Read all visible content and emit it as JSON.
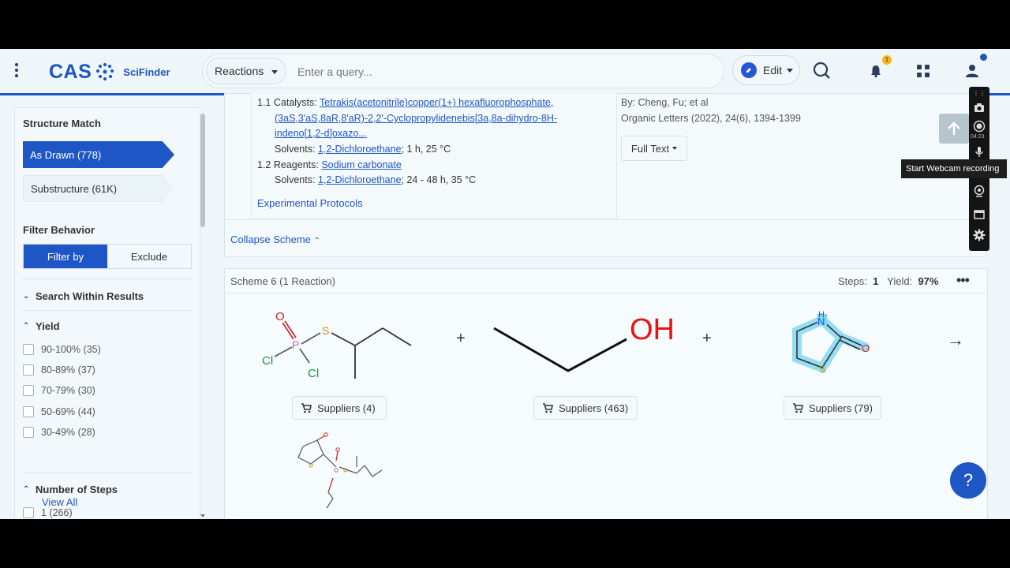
{
  "header": {
    "logo_text": "CAS",
    "product": "SciFinder",
    "search_type": "Reactions",
    "search_placeholder": "Enter a query...",
    "edit_label": "Edit",
    "notification_count": "1",
    "colors": {
      "brand": "#1f56c6",
      "accent_badge": "#f3b81c"
    }
  },
  "sidebar": {
    "structure_match_title": "Structure Match",
    "as_drawn": "As Drawn (778)",
    "substructure": "Substructure (61K)",
    "filter_behavior_title": "Filter Behavior",
    "filter_by": "Filter by",
    "exclude": "Exclude",
    "search_within": "Search Within Results",
    "yield_title": "Yield",
    "yield_options": [
      {
        "label": "90-100%",
        "count": "(35)"
      },
      {
        "label": "80-89%",
        "count": "(37)"
      },
      {
        "label": "70-79%",
        "count": "(30)"
      },
      {
        "label": "50-69%",
        "count": "(44)"
      },
      {
        "label": "30-49%",
        "count": "(28)"
      }
    ],
    "view_all": "View All",
    "steps_title": "Number of Steps",
    "steps_option": {
      "label": "1",
      "count": "(266)"
    }
  },
  "conditions": {
    "step1_prefix": "1.1",
    "catalysts_label": "Catalysts:",
    "catalyst1": "Tetrakis(acetonitrile)copper(1+) hexafluorophosphate,",
    "catalyst2": "(3aS,3'aS,8aR,8'aR)-2,2'-Cyclopropylidenebis[3a,8a-dihydro-8H-",
    "catalyst3": "indeno[1,2-d]oxazo...",
    "solvents_label": "Solvents:",
    "solvent1": "1,2-Dichloroethane",
    "solvent1_cond": "; 1 h, 25 °C",
    "step2_prefix": "1.2",
    "reagents_label": "Reagents:",
    "reagent": "Sodium carbonate",
    "solvent2": "1,2-Dichloroethane",
    "solvent2_cond": "; 24 - 48 h, 35 °C",
    "experimental_protocols": "Experimental Protocols"
  },
  "reference": {
    "byline": "By: Cheng, Fu; et al",
    "journal": "Organic Letters (2022), 24(6), 1394-1399",
    "full_text": "Full Text"
  },
  "collapse_scheme": "Collapse Scheme",
  "scheme": {
    "title": "Scheme 6",
    "reactions": "(1 Reaction)",
    "steps_label": "Steps:",
    "steps_value": "1",
    "yield_label": "Yield:",
    "yield_value": "97%",
    "suppliers": [
      "Suppliers (4)",
      "Suppliers (463)",
      "Suppliers (79)"
    ],
    "atoms": {
      "o": "O",
      "s": "S",
      "p": "P",
      "cl": "Cl",
      "oh": "OH",
      "h": "H",
      "n": "N"
    }
  },
  "recorder": {
    "tooltip": "Start Webcam recording",
    "timer": "04:23"
  },
  "help_label": "?"
}
